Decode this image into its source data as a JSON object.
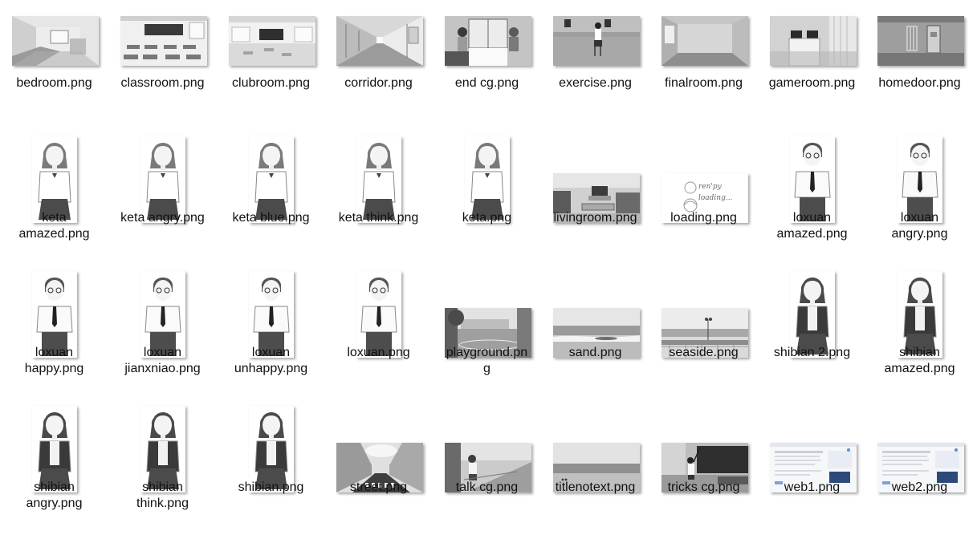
{
  "files": [
    {
      "name": "bedroom.png",
      "kind": "bedroom"
    },
    {
      "name": "classroom.png",
      "kind": "classroom"
    },
    {
      "name": "clubroom.png",
      "kind": "clubroom"
    },
    {
      "name": "corridor.png",
      "kind": "corridor"
    },
    {
      "name": "end cg.png",
      "kind": "endcg"
    },
    {
      "name": "exercise.png",
      "kind": "exercise"
    },
    {
      "name": "finalroom.png",
      "kind": "finalroom"
    },
    {
      "name": "gameroom.png",
      "kind": "gameroom"
    },
    {
      "name": "homedoor.png",
      "kind": "homedoor"
    },
    {
      "name": "keta amazed.png",
      "kind": "girl"
    },
    {
      "name": "keta angry.png",
      "kind": "girl"
    },
    {
      "name": "keta blue.png",
      "kind": "girl"
    },
    {
      "name": "keta think.png",
      "kind": "girl"
    },
    {
      "name": "keta.png",
      "kind": "girl"
    },
    {
      "name": "livingroom.png",
      "kind": "livingroom"
    },
    {
      "name": "loading.png",
      "kind": "loading"
    },
    {
      "name": "loxuan amazed.png",
      "kind": "boy"
    },
    {
      "name": "loxuan angry.png",
      "kind": "boy"
    },
    {
      "name": "loxuan happy.png",
      "kind": "boy"
    },
    {
      "name": "loxuan jianxniao.png",
      "kind": "boy"
    },
    {
      "name": "loxuan unhappy.png",
      "kind": "boy"
    },
    {
      "name": "loxuan.png",
      "kind": "boy"
    },
    {
      "name": "playground.png",
      "kind": "playground"
    },
    {
      "name": "sand.png",
      "kind": "sand"
    },
    {
      "name": "seaside.png",
      "kind": "seaside"
    },
    {
      "name": "shibian 2.png",
      "kind": "girl2"
    },
    {
      "name": "shibian amazed.png",
      "kind": "girl2"
    },
    {
      "name": "shibian angry.png",
      "kind": "girl2"
    },
    {
      "name": "shibian think.png",
      "kind": "girl2"
    },
    {
      "name": "shibian.png",
      "kind": "girl2"
    },
    {
      "name": "street.png",
      "kind": "street"
    },
    {
      "name": "talk cg.png",
      "kind": "talkcg"
    },
    {
      "name": "titlenotext.png",
      "kind": "title"
    },
    {
      "name": "tricks cg.png",
      "kind": "tricks"
    },
    {
      "name": "web1.png",
      "kind": "web"
    },
    {
      "name": "web2.png",
      "kind": "web"
    }
  ],
  "loading_text": "ren'py loading..."
}
